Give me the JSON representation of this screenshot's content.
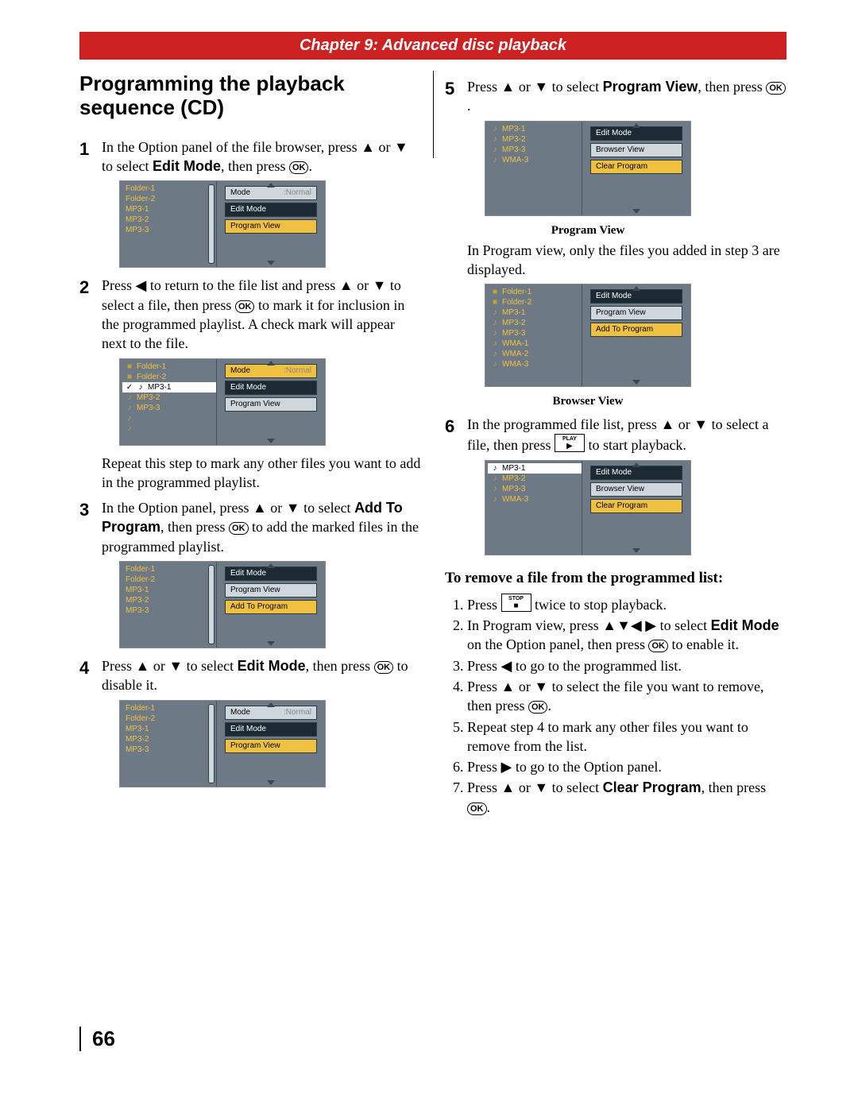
{
  "chapter": "Chapter 9: Advanced disc playback",
  "title": "Programming the playback sequence (CD)",
  "page_num": "66",
  "ok": "OK",
  "btn_stop_label": "STOP",
  "btn_stop": "■",
  "btn_play_label": "PLAY",
  "btn_play": "▶",
  "steps": {
    "s1a": "In the Option panel of the file browser, press ▲ or ▼ to select ",
    "s1b": "Edit Mode",
    "s1c": ", then press ",
    "s2a": "Press ◀ to return to the file list and press ▲ or ▼ to select a file, then press ",
    "s2b": " to mark it for inclusion in the programmed playlist. A check mark will appear next to the file.",
    "s2_after": "Repeat this step to mark any other files you want to add in the programmed playlist.",
    "s3a": "In the Option panel, press ▲ or ▼ to select ",
    "s3b": "Add To Program",
    "s3c": ", then press ",
    "s3d": " to add the marked files in the programmed playlist.",
    "s4a": "Press ▲ or ▼ to select ",
    "s4b": "Edit Mode",
    "s4c": ", then press ",
    "s4d": " to disable it.",
    "s5a": "Press ▲ or ▼ to select ",
    "s5b": "Program View",
    "s5c": ", then press ",
    "s5_after": "In Program view, only the files you added in step 3 are displayed.",
    "s6a": "In the programmed file list, press ▲ or ▼ to select a file, then press ",
    "s6b": " to start playback."
  },
  "caption_program": "Program View",
  "caption_browser": "Browser View",
  "remove_heading": "To remove a file from the programmed list:",
  "remove": {
    "r1a": "Press ",
    "r1b": " twice to stop playback.",
    "r2a": "In Program view, press ▲▼◀ ▶ to select ",
    "r2b": "Edit Mode",
    "r2c": " on the Option panel, then press ",
    "r2d": " to enable it.",
    "r3": "Press ◀ to go to the programmed list.",
    "r4a": "Press ▲ or ▼ to select the file you want to remove, then press ",
    "r5": "Repeat step 4 to mark any other files you want to remove from the list.",
    "r6": "Press ▶ to go to the Option panel.",
    "r7a": "Press ▲ or ▼ to select ",
    "r7b": "Clear Program",
    "r7c": ", then press "
  },
  "ui": {
    "folder1": "Folder-1",
    "folder2": "Folder-2",
    "mp31": "MP3-1",
    "mp32": "MP3-2",
    "mp33": "MP3-3",
    "wma1": "WMA-1",
    "wma2": "WMA-2",
    "wma3": "WMA-3",
    "mode": "Mode",
    "normal": ":Normal",
    "edit": "Edit Mode",
    "progview": "Program View",
    "browview": "Browser View",
    "addprog": "Add To Program",
    "clearprog": "Clear Program"
  }
}
